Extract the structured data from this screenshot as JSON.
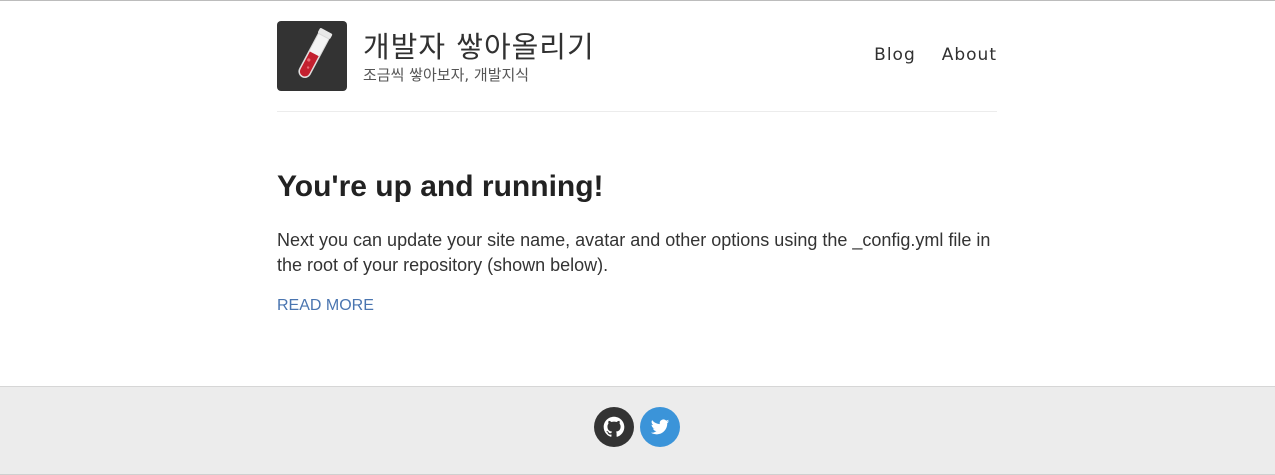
{
  "header": {
    "site_name": "개발자 쌓아올리기",
    "site_description": "조금씩 쌓아보자, 개발지식",
    "avatar_icon": "test-tube-icon",
    "nav": [
      {
        "label": "Blog"
      },
      {
        "label": "About"
      }
    ]
  },
  "post": {
    "title": "You're up and running!",
    "excerpt": "Next you can update your site name, avatar and other options using the _config.yml file in the root of your repository (shown below).",
    "read_more": "READ MORE"
  },
  "footer": {
    "social": [
      {
        "name": "github",
        "icon": "github-icon",
        "color": "#333333"
      },
      {
        "name": "twitter",
        "icon": "twitter-icon",
        "color": "#3b94d9"
      }
    ]
  },
  "colors": {
    "link": "#4a75b0",
    "footer_bg": "#ececec",
    "avatar_bg": "#333333",
    "tube_liquid": "#c3202f"
  }
}
